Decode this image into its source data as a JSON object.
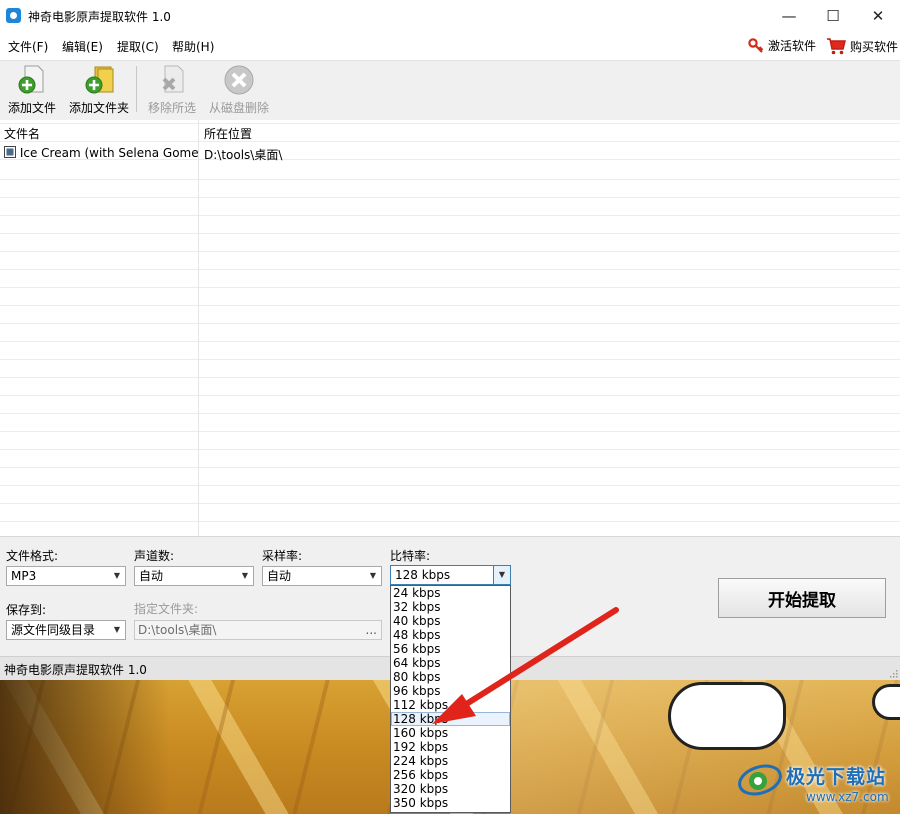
{
  "titlebar": {
    "title": "神奇电影原声提取软件 1.0",
    "minimize": "—",
    "maximize": "☐",
    "close": "✕"
  },
  "menu": {
    "items": [
      "文件(F)",
      "编辑(E)",
      "提取(C)",
      "帮助(H)"
    ],
    "activate_label": "激活软件",
    "buy_label": "购买软件"
  },
  "toolbar": {
    "add_file": "添加文件",
    "add_folder": "添加文件夹",
    "remove_selected": "移除所选",
    "delete_from_disk": "从磁盘删除"
  },
  "list": {
    "columns": [
      "文件名",
      "所在位置"
    ],
    "rows": [
      {
        "name": "Ice Cream (with Selena Gome...",
        "location": "D:\\tools\\桌面\\"
      }
    ]
  },
  "settings": {
    "format_label": "文件格式:",
    "format_value": "MP3",
    "channels_label": "声道数:",
    "channels_value": "自动",
    "samplerate_label": "采样率:",
    "samplerate_value": "自动",
    "bitrate_label": "比特率:",
    "bitrate_value": "128 kbps",
    "saveto_label": "保存到:",
    "saveto_value": "源文件同级目录",
    "folder_label": "指定文件夹:",
    "folder_value": "D:\\tools\\桌面\\",
    "browse": "...",
    "start_button": "开始提取"
  },
  "bitrate_options": [
    "24 kbps",
    "32 kbps",
    "40 kbps",
    "48 kbps",
    "56 kbps",
    "64 kbps",
    "80 kbps",
    "96 kbps",
    "112 kbps",
    "128 kbps",
    "160 kbps",
    "192 kbps",
    "224 kbps",
    "256 kbps",
    "320 kbps",
    "350 kbps"
  ],
  "bitrate_selected_index": 9,
  "status": {
    "text": "神奇电影原声提取软件 1.0"
  },
  "watermark": {
    "brand": "极光下载站",
    "url": "www.xz7.com"
  },
  "colors": {
    "accent": "#1d86d8",
    "arrow": "#e0241b",
    "watermark": "#1e6fb7"
  }
}
